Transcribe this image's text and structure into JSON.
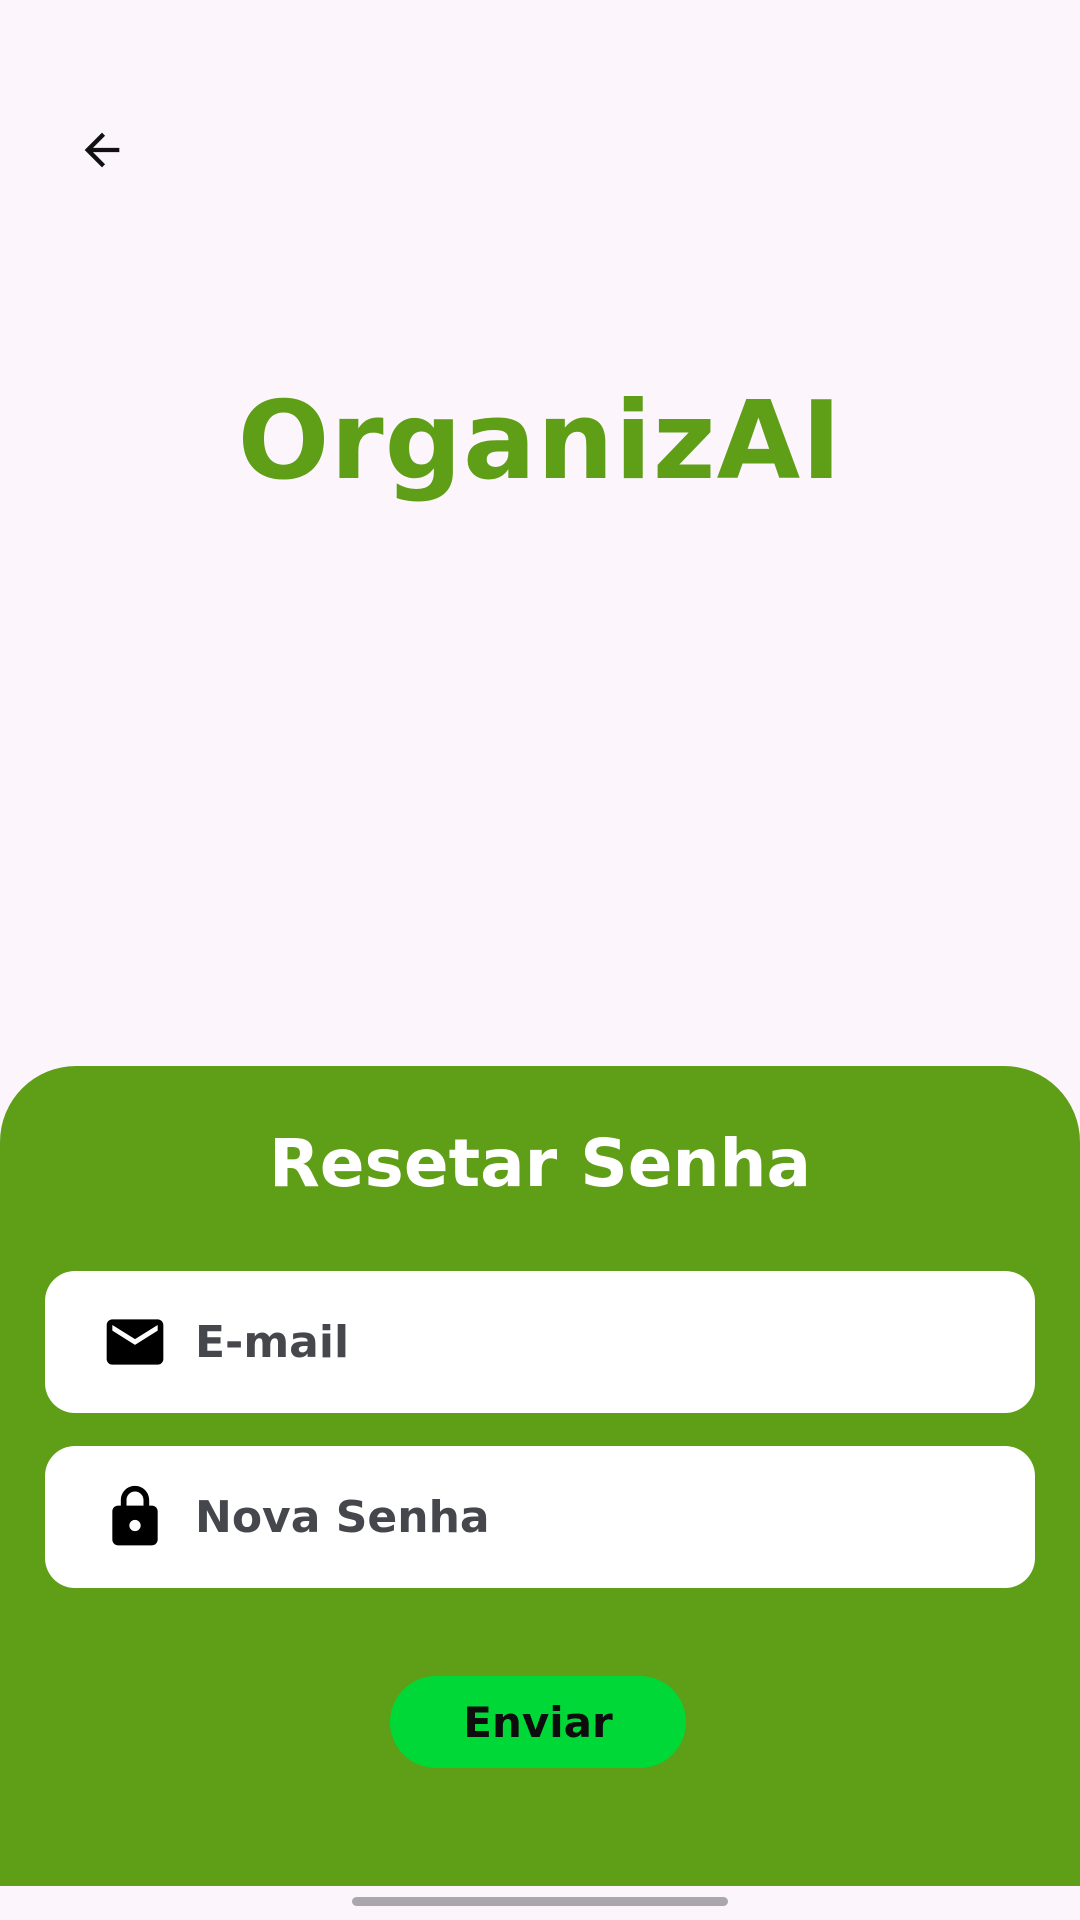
{
  "colors": {
    "background": "#fcf5fb",
    "brand_green": "#5f9e17",
    "button_green": "#00d838",
    "field_background": "#ffffff",
    "placeholder_text": "#45474d"
  },
  "header": {
    "back_icon": "arrow-left-icon"
  },
  "brand": {
    "title": "OrganizAI"
  },
  "reset_form": {
    "title": "Resetar Senha",
    "email": {
      "icon": "mail-icon",
      "placeholder": "E-mail",
      "value": ""
    },
    "new_password": {
      "icon": "lock-icon",
      "placeholder": "Nova Senha",
      "value": ""
    },
    "submit_label": "Enviar"
  }
}
